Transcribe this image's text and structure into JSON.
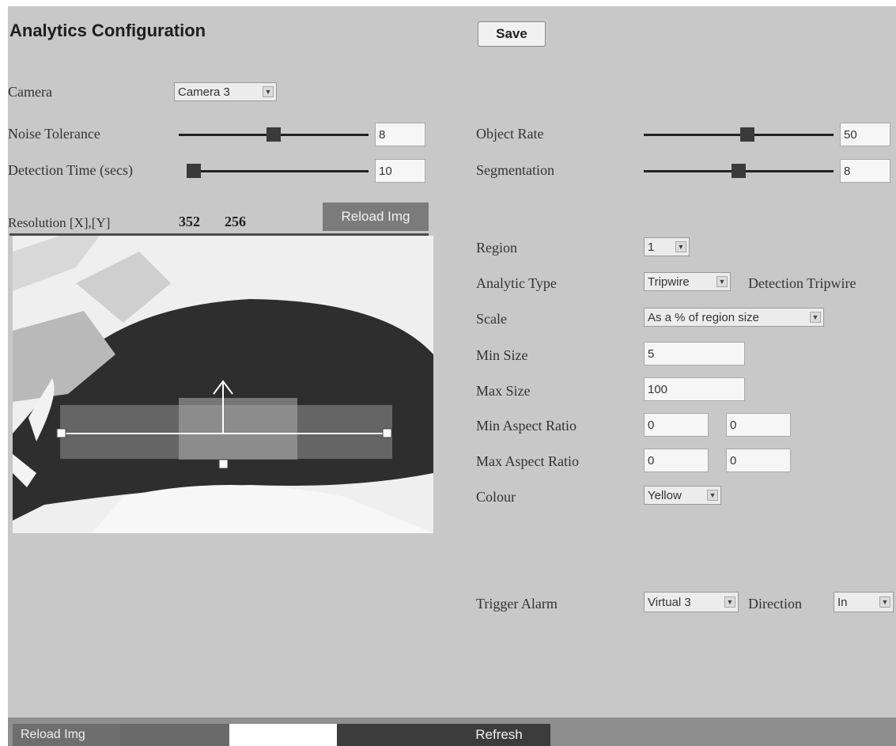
{
  "page": {
    "title": "Analytics Configuration",
    "save_label": "Save"
  },
  "camera": {
    "label": "Camera",
    "selected": "Camera 3"
  },
  "noise_tolerance": {
    "label": "Noise Tolerance",
    "value": "8",
    "level": 0.5
  },
  "detection_time": {
    "label": "Detection Time (secs)",
    "value": "10",
    "level": 0.0
  },
  "object_rate": {
    "label": "Object Rate",
    "value": "50",
    "level": 0.55
  },
  "segmentation": {
    "label": "Segmentation",
    "value": "8",
    "level": 0.5
  },
  "resolution": {
    "label": "Resolution [X],[Y]",
    "x": "352",
    "y": "256",
    "reload_label": "Reload Img"
  },
  "region": {
    "label": "Region",
    "selected": "1"
  },
  "analytic_type": {
    "label": "Analytic Type",
    "selected": "Tripwire",
    "detail": "Detection Tripwire"
  },
  "scale": {
    "label": "Scale",
    "selected": "As a % of region size"
  },
  "min_size": {
    "label": "Min Size",
    "value": "5"
  },
  "max_size": {
    "label": "Max Size",
    "value": "100"
  },
  "min_aspect": {
    "label": "Min Aspect Ratio",
    "value1": "0",
    "value2": "0"
  },
  "max_aspect": {
    "label": "Max Aspect Ratio",
    "value1": "0",
    "value2": "0"
  },
  "colour": {
    "label": "Colour",
    "selected": "Yellow"
  },
  "trigger_alarm": {
    "label": "Trigger Alarm",
    "selected": "Virtual 3",
    "direction_label": "Direction",
    "direction": "In"
  },
  "bottom_bar": {
    "reload_label": "Reload Img",
    "refresh_label": "Refresh"
  },
  "icons": {
    "dropdown": "chevron-down-icon",
    "tripwire_arrow": "arrow-up-icon"
  },
  "colors": {
    "panel_bg": "#c8c8c8",
    "slider_track": "#222222",
    "refresh_bg": "#3c3c3c"
  }
}
